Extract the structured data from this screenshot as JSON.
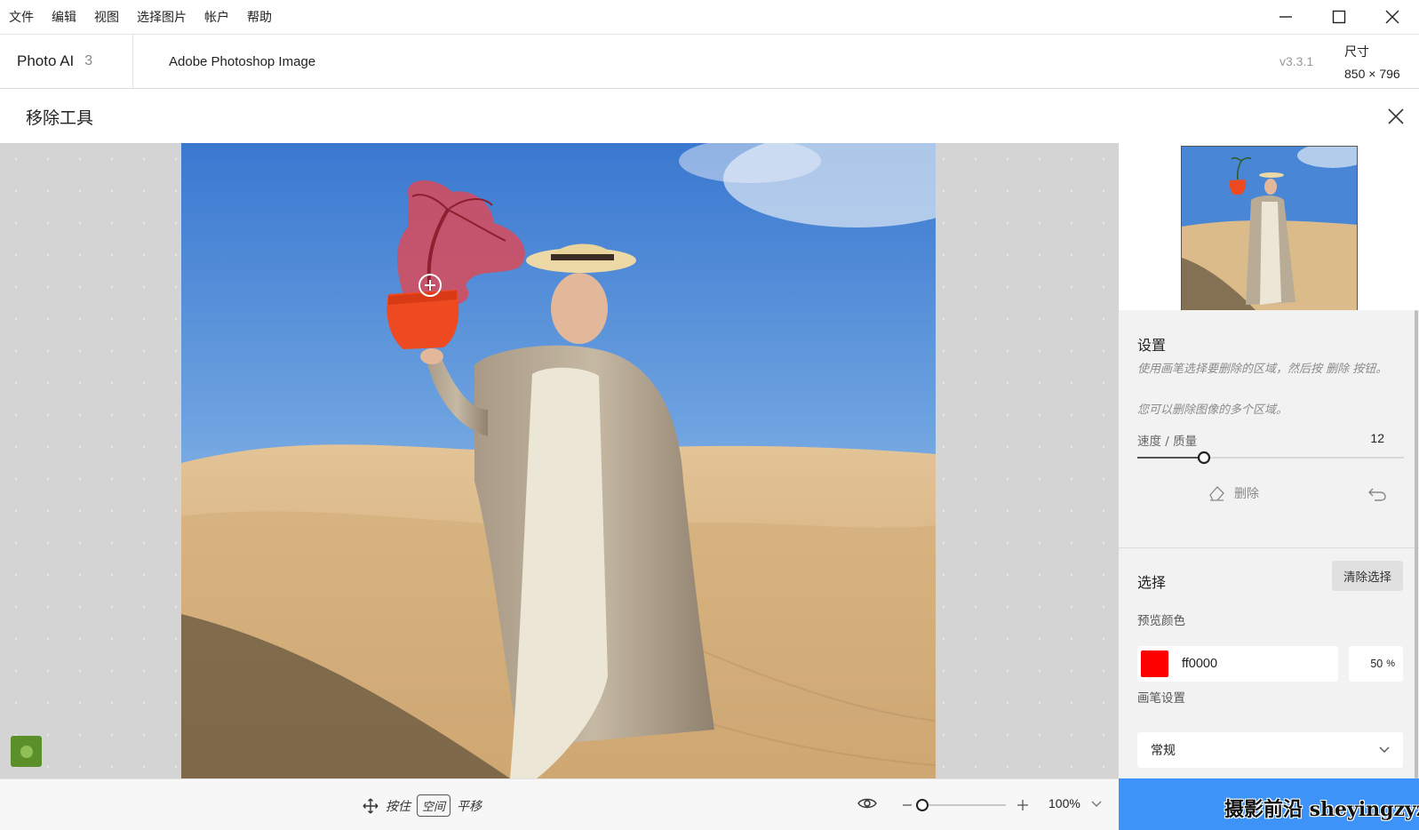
{
  "menu": [
    "文件",
    "编辑",
    "视图",
    "选择图片",
    "帐户",
    "帮助"
  ],
  "header": {
    "app_name": "Photo AI",
    "app_version_num": "3",
    "document": "Adobe Photoshop Image",
    "version": "v3.3.1",
    "dims_label": "尺寸",
    "dims_value": "850 × 796"
  },
  "tool": {
    "title": "移除工具"
  },
  "bottombar": {
    "hold": "按住",
    "key": "空间",
    "pan": "平移",
    "zoom_value": "100%"
  },
  "settings": {
    "title": "设置",
    "note1": "使用画笔选择要删除的区域，然后按 删除 按钮。",
    "note2": "您可以删除图像的多个区域。",
    "speed_label": "速度 / 质量",
    "speed_value": "12",
    "speed_level": 0.25,
    "delete_label": "删除"
  },
  "selection": {
    "title": "选择",
    "clear_label": "清除选择",
    "preview_color_label": "预览颜色",
    "color_hex": "ff0000",
    "swatch_color": "#ff0000",
    "opacity": "50",
    "opacity_unit": "%",
    "brush_label": "画笔设置",
    "brush_mode": "常规"
  },
  "watermark": "摄影前沿 sheyingzyz.com",
  "colors": {
    "accent": "#3d93f7",
    "mask": "#e8304a",
    "sky_top": "#3f7fd8",
    "sand": "#d9b483"
  }
}
